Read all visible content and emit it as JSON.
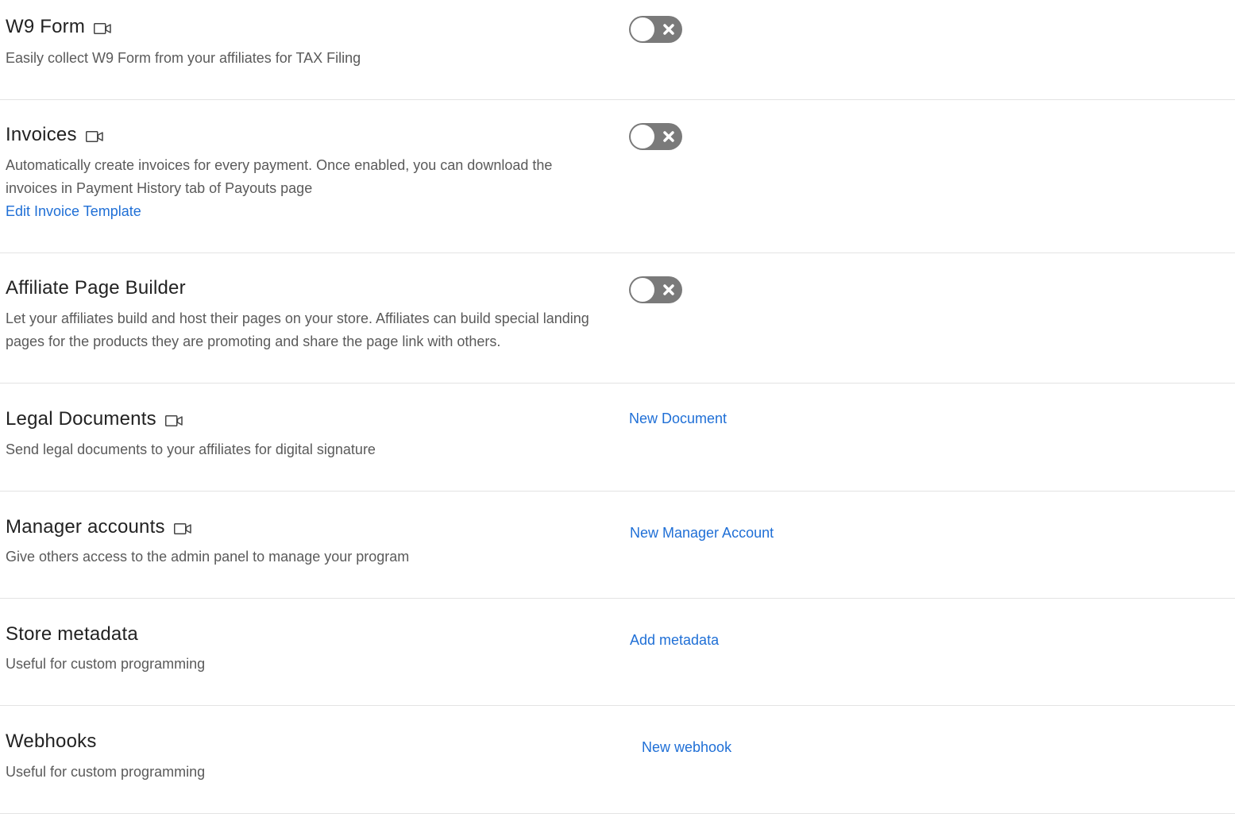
{
  "features": {
    "w9": {
      "title": "W9 Form",
      "description": "Easily collect W9 Form from your affiliates for TAX Filing",
      "toggle_state": "off"
    },
    "invoices": {
      "title": "Invoices",
      "description": "Automatically create invoices for every payment. Once enabled, you can download the invoices in Payment History tab of Payouts page",
      "link": "Edit Invoice Template",
      "toggle_state": "off"
    },
    "page_builder": {
      "title": "Affiliate Page Builder",
      "description": "Let your affiliates build and host their pages on your store. Affiliates can build special landing pages for the products they are promoting and share the page link with others.",
      "toggle_state": "off"
    },
    "legal_documents": {
      "title": "Legal Documents",
      "description": "Send legal documents to your affiliates for digital signature",
      "action": "New Document"
    },
    "manager_accounts": {
      "title": "Manager accounts",
      "description": "Give others access to the admin panel to manage your program",
      "action": "New Manager Account"
    },
    "store_metadata": {
      "title": "Store metadata",
      "description": "Useful for custom programming",
      "action": "Add metadata"
    },
    "webhooks": {
      "title": "Webhooks",
      "description": "Useful for custom programming",
      "action": "New webhook"
    }
  },
  "icons": {
    "video": "video-camera-icon",
    "toggle_off": "close-icon"
  },
  "colors": {
    "link": "#1f6fd6",
    "toggle_off_bg": "#7a7a7a",
    "title": "#222222",
    "description": "#5a5a5a",
    "divider": "#e3e3e3"
  }
}
